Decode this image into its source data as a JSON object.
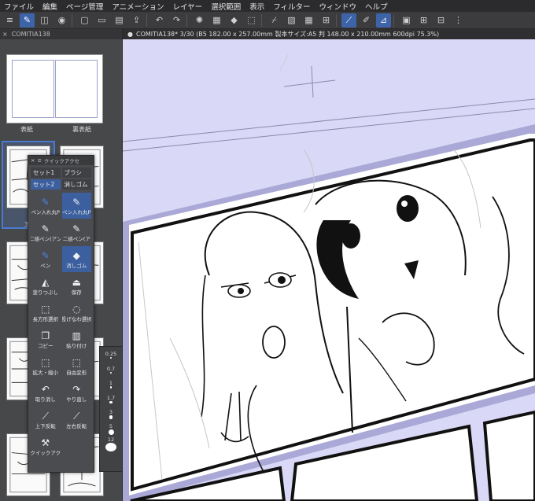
{
  "menu": [
    "ファイル",
    "編集",
    "ページ管理",
    "アニメーション",
    "レイヤー",
    "選択範囲",
    "表示",
    "フィルター",
    "ウィンドウ",
    "ヘルプ"
  ],
  "toolbar_icons": [
    "pen-mode-icon",
    "layers-icon",
    "quick-access-icon",
    "new-icon",
    "open-icon",
    "save-icon",
    "undo-icon",
    "redo-icon",
    "settings-icon",
    "fill-icon",
    "transform-icon",
    "delete-icon",
    "clear-icon",
    "selection-icon",
    "snap-ruler-icon",
    "snap-grid-icon",
    "snap-special-icon",
    "correction-icon",
    "layout-icon",
    "stabilizer-icon"
  ],
  "left_panel": {
    "title": "COMITIA138",
    "cover_labels": [
      "表紙",
      "裏表紙"
    ],
    "selected_page_label": "3"
  },
  "document": {
    "tab_title": "COMITIA138* 3/30 (B5 182.00 x 257.00mm 製本サイズ:A5 判 148.00 x 210.00mm 600dpi 75.3%)"
  },
  "quick_access": {
    "title": "クイックアクセ",
    "tabs": [
      {
        "label": "セット1",
        "active": false
      },
      {
        "label": "ブラシ",
        "active": false
      },
      {
        "label": "セット2",
        "active": true
      },
      {
        "label": "消しゴム",
        "active": false
      }
    ],
    "items": [
      {
        "label": "ペン入れ丸P",
        "icon": "pen-blue-icon",
        "active": false,
        "blue": true
      },
      {
        "label": "ペン入れ丸P",
        "icon": "pen-icon",
        "active": true,
        "blue": false
      },
      {
        "label": "二値ペン(アン",
        "icon": "pen-icon",
        "active": false,
        "blue": false
      },
      {
        "label": "二値ペン(ア",
        "icon": "pen-icon",
        "active": false,
        "blue": false
      },
      {
        "label": "ペン",
        "icon": "pen-blue-icon",
        "active": false,
        "blue": true
      },
      {
        "label": "消しゴム",
        "icon": "eraser-icon",
        "active": true,
        "blue": false
      },
      {
        "label": "塗りつぶし",
        "icon": "bucket-icon",
        "active": false,
        "blue": false
      },
      {
        "label": "保存",
        "icon": "save-icon",
        "active": false,
        "blue": false
      },
      {
        "label": "長方形選択",
        "icon": "rect-select-icon",
        "active": false,
        "blue": false
      },
      {
        "label": "投げなわ選択",
        "icon": "lasso-icon",
        "active": false,
        "blue": false
      },
      {
        "label": "コピー",
        "icon": "copy-icon",
        "active": false,
        "blue": false
      },
      {
        "label": "貼り付け",
        "icon": "paste-icon",
        "active": false,
        "blue": false
      },
      {
        "label": "拡大・縮小",
        "icon": "scale-icon",
        "active": false,
        "blue": false
      },
      {
        "label": "自由変形",
        "icon": "free-transform-icon",
        "active": false,
        "blue": false
      },
      {
        "label": "取り消し",
        "icon": "undo-icon",
        "active": false,
        "blue": false
      },
      {
        "label": "やり直し",
        "icon": "redo-icon",
        "active": false,
        "blue": false
      },
      {
        "label": "上下反転",
        "icon": "flip-vertical-icon",
        "active": false,
        "blue": false
      },
      {
        "label": "左右反転",
        "icon": "flip-horizontal-icon",
        "active": false,
        "blue": false
      },
      {
        "label": "クイックアク",
        "icon": "wrench-icon",
        "active": false,
        "blue": false
      }
    ]
  },
  "brush_sizes": [
    "0.25",
    "0.7",
    "1",
    "1.7",
    "3",
    "5",
    "12"
  ],
  "colors": {
    "accent": "#3b5f9f",
    "canvas_bg": "#d9d8f6",
    "panel": "#47484a"
  }
}
